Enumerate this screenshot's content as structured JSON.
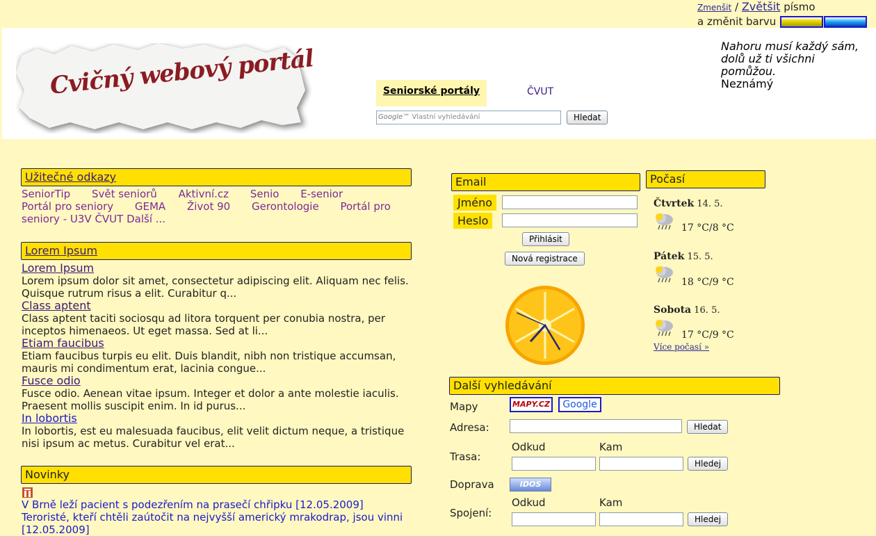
{
  "font_controls": {
    "smaller": "Zmenšit",
    "separator": "/",
    "bigger": "Zvětšit",
    "font_word": "písmo",
    "change_color": "a změnit barvu",
    "swatch_colors": [
      "#e8d800",
      "#2aa8ff"
    ]
  },
  "header": {
    "logo_text": "Cvičný webový portál",
    "tab_senior": "Seniorské portály",
    "tab_cvut": "ČVUT",
    "search_brand": "Google™",
    "search_placeholder": "Vlastní vyhledávání",
    "search_button": "Hledat",
    "quote_lines": [
      "Nahoru musí každý sám,",
      "dolů už ti všichni",
      "pomůžou."
    ],
    "quote_author": "Neznámý"
  },
  "useful_links": {
    "title": "Užitečné odkazy",
    "items": [
      "SeniorTip",
      "Svět seniorů",
      "Aktivní.cz",
      "Senio",
      "E-senior",
      "Portál pro seniory",
      "GEMA",
      "Život 90",
      "Gerontologie",
      "Portál pro seniory - U3V ČVUT",
      "Další ..."
    ]
  },
  "lorem": {
    "title": "Lorem Ipsum",
    "items": [
      {
        "title": "Lorem Ipsum",
        "body": "Lorem ipsum dolor sit amet, consectetur adipiscing elit. Aliquam nec felis. Quisque rutrum risus a elit. Curabitur q..."
      },
      {
        "title": "Class aptent",
        "body": "Class aptent taciti sociosqu ad litora torquent per conubia nostra, per inceptos himenaeos. Ut eget massa. Sed at li..."
      },
      {
        "title": "Etiam faucibus",
        "body": "Etiam faucibus turpis eu elit. Duis blandit, nibh non tristique accumsan, mauris mi condimentum erat, lacinia congue..."
      },
      {
        "title": "Fusce odio",
        "body": "Fusce odio. Aenean vitae ipsum. Integer et dolor a ante molestie iaculis. Praesent mollis suscipit enim. In id purus..."
      },
      {
        "title": "In lobortis",
        "body": "In lobortis, est eu malesuada faucibus, elit velit dictum neque, a tristique nisi ipsum ac metus. Curabitur vel erat..."
      }
    ]
  },
  "news": {
    "title": "Novinky",
    "items": [
      "V Brně leží pacient s podezřením na prasečí chřipku [12.05.2009]",
      "Teroristé, kteří chtěli zaútočit na nejvyšší americký mrakodrap, jsou vinni [12.05.2009]"
    ]
  },
  "email": {
    "title": "Email",
    "name_label": "Jméno",
    "pass_label": "Heslo",
    "login_button": "Přihlásit",
    "register_button": "Nová registrace"
  },
  "clock": {
    "hour": 7,
    "minute": 24,
    "second": 49
  },
  "weather": {
    "title": "Počasí",
    "days": [
      {
        "day": "Čtvrtek",
        "date": "14. 5.",
        "temp": "17 °C/8 °C",
        "icon": "cloud-rain-icon"
      },
      {
        "day": "Pátek",
        "date": "15. 5.",
        "temp": "18 °C/9 °C",
        "icon": "cloud-rain-icon"
      },
      {
        "day": "Sobota",
        "date": "16. 5.",
        "temp": "17 °C/9 °C",
        "icon": "cloud-rain-icon"
      }
    ],
    "more": "Více počasí »"
  },
  "search": {
    "title": "Další vyhledávání",
    "maps_label": "Mapy",
    "mapy_cz": "MAPY.CZ",
    "google": "Google",
    "address_label": "Adresa:",
    "address_button": "Hledat",
    "from_label": "Odkud",
    "to_label": "Kam",
    "route_label": "Trasa:",
    "route_button": "Hledej",
    "transport_label": "Doprava",
    "idos": "IDOS",
    "connection_label": "Spojení:",
    "connection_button": "Hledej"
  }
}
